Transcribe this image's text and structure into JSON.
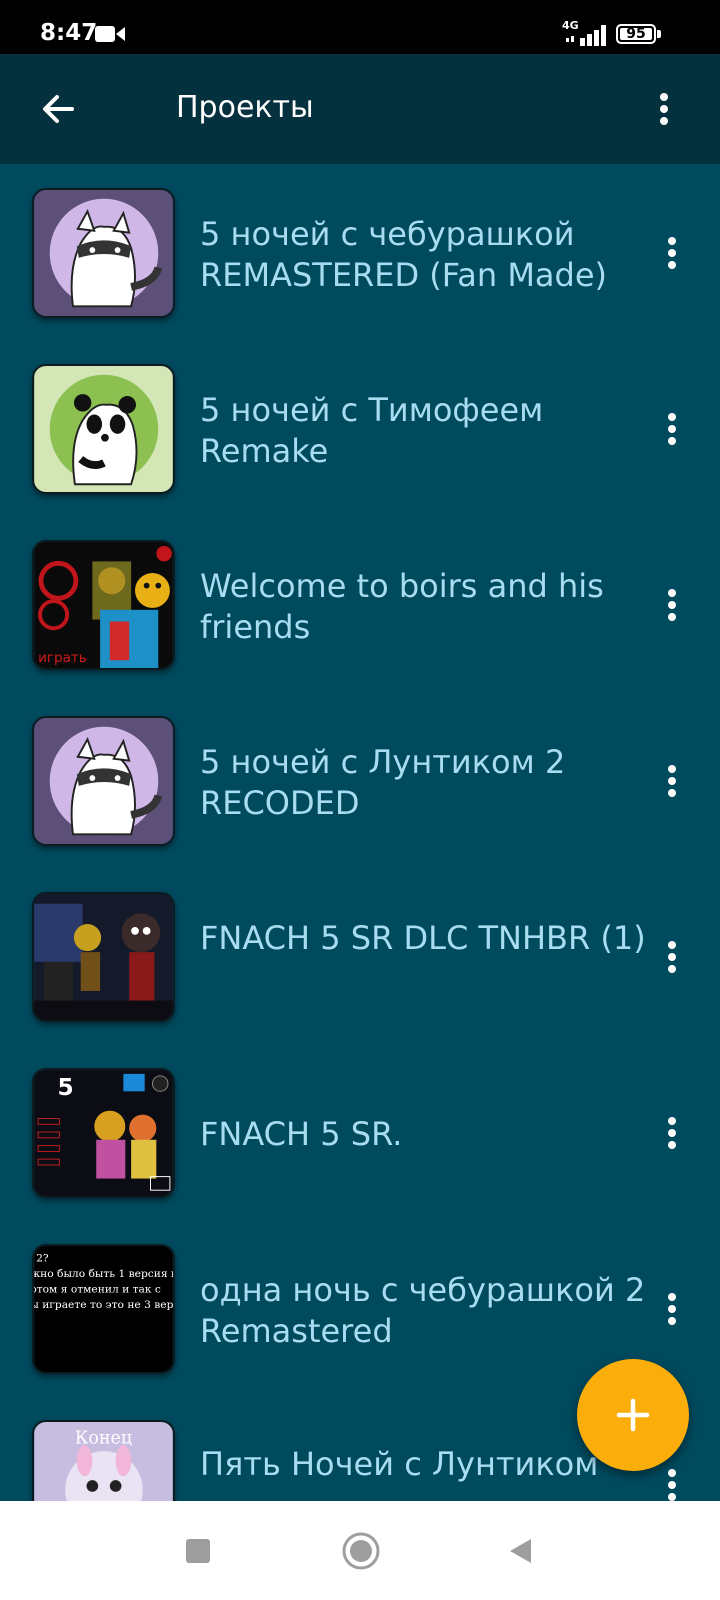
{
  "status_bar": {
    "time": "8:47",
    "network": "4G",
    "battery": "95",
    "icons": [
      "video-camera-icon",
      "signal-icon",
      "battery-icon"
    ]
  },
  "app_bar": {
    "title": "Проекты",
    "icons": [
      "back-arrow-icon",
      "more-vert-icon"
    ]
  },
  "projects": [
    {
      "title": "5 ночей с чебурашкой REMASTERED (Fan Made)",
      "thumbnail": "raccoon-avatar"
    },
    {
      "title": "5 ночей с Тимофеем Remake",
      "thumbnail": "panda-avatar"
    },
    {
      "title": "Welcome to boirs and his friends",
      "thumbnail": "game-screenshot"
    },
    {
      "title": "5 ночей с Лунтиком 2 RECODED",
      "thumbnail": "raccoon-avatar"
    },
    {
      "title": "FNACH 5 SR DLC TNHBR (1)",
      "thumbnail": "game-screenshot"
    },
    {
      "title": "FNACH 5 SR.",
      "thumbnail": "game-screenshot"
    },
    {
      "title": "одна ночь с чебурашкой 2 Remastered",
      "thumbnail": "text-screenshot"
    },
    {
      "title": "Пять Ночей с Лунтиком",
      "thumbnail": "game-screenshot"
    }
  ],
  "thumb_text": {
    "item3": "играть",
    "item6": "5",
    "item7_lines": [
      "2?",
      "жно было быть 1 версия п",
      "отом я отменил и так с",
      "ы играете то это не 3 вер"
    ],
    "item8": "Конец"
  },
  "fab": {
    "icon": "add-icon",
    "color": "#fbad0b"
  },
  "nav_bar": {
    "icons": [
      "recents-square-icon",
      "home-circle-icon",
      "back-triangle-icon"
    ]
  },
  "colors": {
    "background": "#004a5e",
    "app_bar": "#05303d",
    "item_title": "#a8dcf0",
    "accent": "#fbad0b"
  }
}
